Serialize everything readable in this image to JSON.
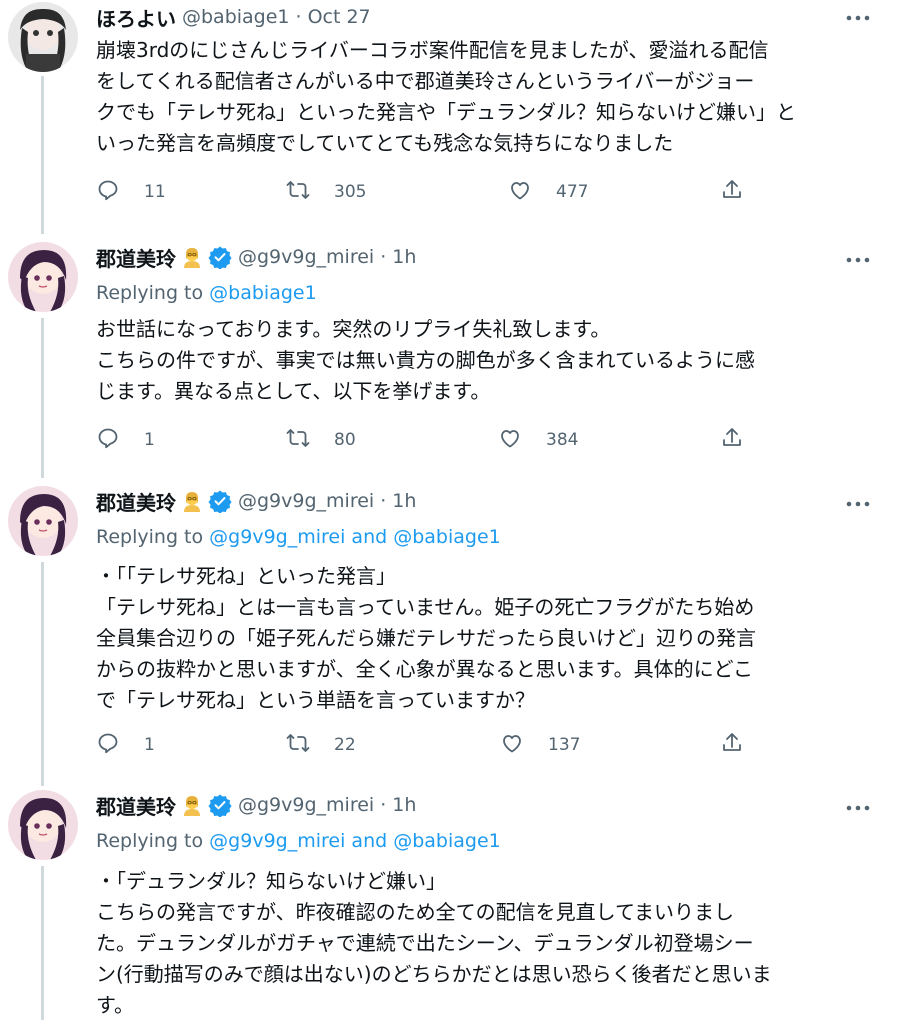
{
  "tweets": [
    {
      "name": "ほろよい",
      "handle": "@babiage1",
      "separator": "·",
      "time": "Oct 27",
      "body": "崩壊3rdのにじさんじライバーコラボ案件配信を見ましたが、愛溢れる配信\nをしてくれる配信者さんがいる中で郡道美玲さんというライバーがジョー\nクでも「テレサ死ね」といった発言や「デュランダル？知らないけど嫌い」と\nいった発言を高頻度でしていてとても残念な気持ちになりました",
      "replies": "11",
      "retweets": "305",
      "likes": "477"
    },
    {
      "name": "郡道美玲",
      "handle": "@g9v9g_mirei",
      "separator": "·",
      "time": "1h",
      "reply_prefix": "Replying to",
      "reply_users": [
        "@babiage1"
      ],
      "reply_and": "",
      "body": "お世話になっております。突然のリプライ失礼致します。\nこちらの件ですが、事実では無い貴方の脚色が多く含まれているように感\nじます。異なる点として、以下を挙げます。",
      "replies": "1",
      "retweets": "80",
      "likes": "384"
    },
    {
      "name": "郡道美玲",
      "handle": "@g9v9g_mirei",
      "separator": "·",
      "time": "1h",
      "reply_prefix": "Replying to",
      "reply_users": [
        "@g9v9g_mirei",
        "@babiage1"
      ],
      "reply_and": "and",
      "body": "・「「テレサ死ね」といった発言」\n「テレサ死ね」とは一言も言っていません。姫子の死亡フラグがたち始め\n全員集合辺りの「姫子死んだら嫌だテレサだったら良いけど」辺りの発言\nからの抜粋かと思いますが、全く心象が異なると思います。具体的にどこ\nで「テレサ死ね」という単語を言っていますか？",
      "replies": "1",
      "retweets": "22",
      "likes": "137"
    },
    {
      "name": "郡道美玲",
      "handle": "@g9v9g_mirei",
      "separator": "·",
      "time": "1h",
      "reply_prefix": "Replying to",
      "reply_users": [
        "@g9v9g_mirei",
        "@babiage1"
      ],
      "reply_and": "and",
      "body": "・「デュランダル？知らないけど嫌い」\nこちらの発言ですが、昨夜確認のため全ての配信を見直してまいりまし\nた。デュランダルがガチャで連続で出たシーン、デュランダル初登場シー\nン(行動描写のみで顔は出ない)のどちらかだとは思い恐らく後者だと思いま\nす。"
    }
  ],
  "icons": {
    "reply": "reply-icon",
    "retweet": "retweet-icon",
    "like": "heart-icon",
    "share": "share-icon",
    "more": "more-icon",
    "verified": "verified-badge-icon",
    "emoji": "teacher-emoji-icon"
  },
  "colors": {
    "link": "#1d9bf0",
    "muted": "#536471",
    "text": "#0f1419",
    "verified": "#1d9bf0",
    "thread_line": "#cfd9de"
  }
}
